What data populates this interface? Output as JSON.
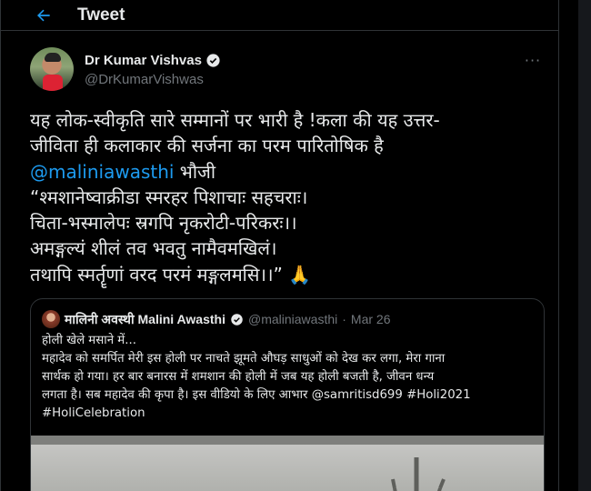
{
  "header": {
    "title": "Tweet",
    "back_icon": "arrow-left-icon"
  },
  "tweet": {
    "author_name": "Dr Kumar Vishvas",
    "author_handle": "@DrKumarVishwas",
    "verified": true,
    "more_icon": "more-horizontal-icon",
    "text_lines": [
      "यह लोक-स्वीकृति सारे सम्मानों पर भारी है !कला की यह उत्तर-",
      "जीविता ही कलाकार की सर्जना का परम पारितोषिक है"
    ],
    "mention": "@maliniawasthi",
    "mention_suffix": " भौजी",
    "verse_lines": [
      "“श्मशानेष्वाक्रीडा स्मरहर पिशाचाः सहचराः।",
      "चिता-भस्मालेपः स्रगपि नृकरोटी-परिकरः।।",
      "अमङ्गल्यं शीलं तव भवतु नामैवमखिलं।",
      "तथापि स्मर्तॄणां वरद परमं मङ्गलमसि।।” 🙏"
    ]
  },
  "quoted_tweet": {
    "author_name": "मालिनी अवस्थी Malini Awasthi",
    "author_handle": "@maliniawasthi",
    "separator": "·",
    "date": "Mar 26",
    "verified": true,
    "text_lines": [
      "होली खेले मसाने में...",
      "महादेव को समर्पित मेरी इस होली पर नाचते झूमते औघड़ साधुओं को देख कर लगा, मेरा गाना",
      "सार्थक हो गया। हर बार बनारस में शमशान की होली में जब यह होली बजती है, जीवन धन्य",
      "लगता है। सब महादेव की कृपा है। इस वीडियो के लिए आभार @samritisd699 #Holi2021",
      "#HoliCelebration"
    ]
  },
  "colors": {
    "background": "#000000",
    "text": "#e7e9ea",
    "secondary": "#71767b",
    "accent": "#1d9bf0",
    "border": "#2f3336"
  }
}
